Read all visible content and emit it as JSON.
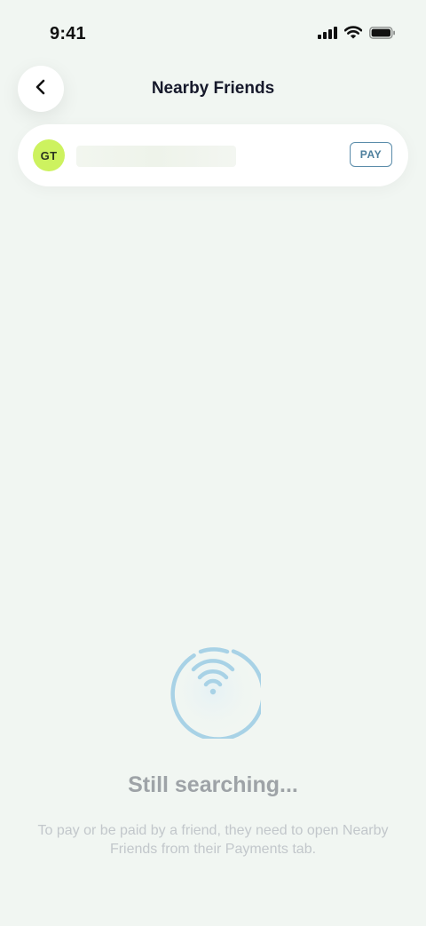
{
  "status_bar": {
    "time": "9:41"
  },
  "header": {
    "title": "Nearby Friends"
  },
  "friend": {
    "initials": "GT",
    "pay_label": "PAY"
  },
  "search": {
    "title": "Still searching...",
    "description": "To pay or be paid by a friend, they need to open Nearby Friends from their Payments tab."
  },
  "colors": {
    "background": "#f1f6f2",
    "avatar": "#cdf25f",
    "pay_accent": "#5a8caa",
    "search_ring": "#a8d2e6"
  },
  "icons": {
    "back": "chevron-left-icon",
    "signal": "signal-icon",
    "wifi": "wifi-icon",
    "battery": "battery-icon",
    "search": "wifi-search-icon"
  }
}
